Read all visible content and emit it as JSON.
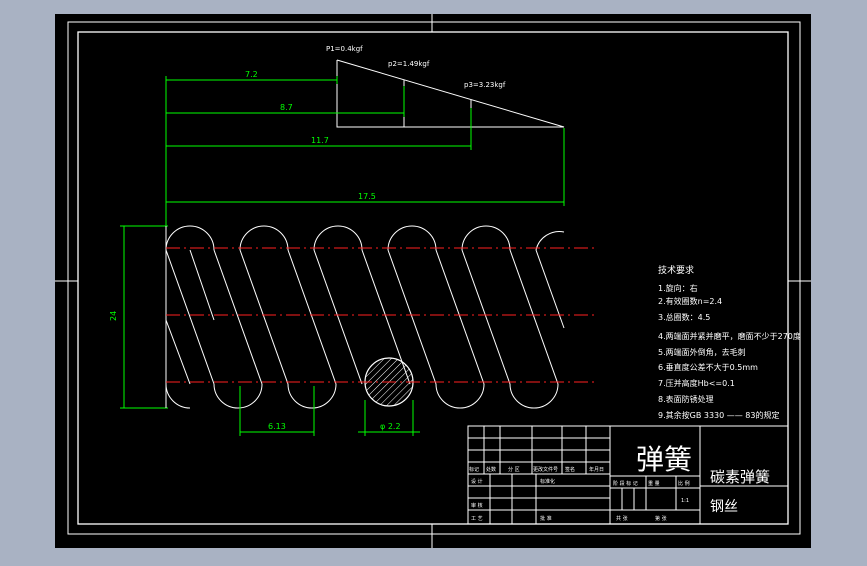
{
  "colors": {
    "background": "#a9b2c3",
    "paper": "#000000",
    "line": "#ffffff",
    "dimension": "#00ff00",
    "centerline": "#ff2020"
  },
  "dimensions": {
    "d_7_2": "7.2",
    "d_8_7": "8.7",
    "d_11_7": "11.7",
    "d_17_5": "17.5",
    "d_height": "24",
    "d_pitch": "6.13",
    "d_wire": "φ 2.2"
  },
  "forces": {
    "p1": "P1=0.4kgf",
    "p2": "p2=1.49kgf",
    "p3": "p3=3.23kgf"
  },
  "tech_requirements": {
    "title": "技术要求",
    "items": [
      "1.旋向：右",
      "2.有效圈数n=2.4",
      "3.总圈数：4.5",
      "4.两端面并紧并磨平，磨面不少于270度",
      "5.两端面外倒角，去毛刺",
      "6.垂直度公差不大于0.5mm",
      "7.压并高度Hb<=0.1",
      "8.表面防锈处理",
      "9.其余按GB 3330 —— 83的规定"
    ]
  },
  "title_block": {
    "part_name": "弹簧",
    "name": "碳素弹簧",
    "material": "钢丝",
    "cells": {
      "biaoji": "标记",
      "chushu": "处数",
      "fenqu": "分 区",
      "wenjian": "更改文件号",
      "qianming": "签名",
      "nianyueri": "年月日",
      "sheji": "设 计",
      "biaozhunhua": "标准化",
      "shenhe": "审 核",
      "gongyi": "工 艺",
      "pizhun": "批 准",
      "jieduan": "阶 段 标 记",
      "zhongliang": "重 量",
      "bili": "比 例",
      "ratio": "1:1",
      "gong": "共 张",
      "di": "第 张"
    }
  }
}
